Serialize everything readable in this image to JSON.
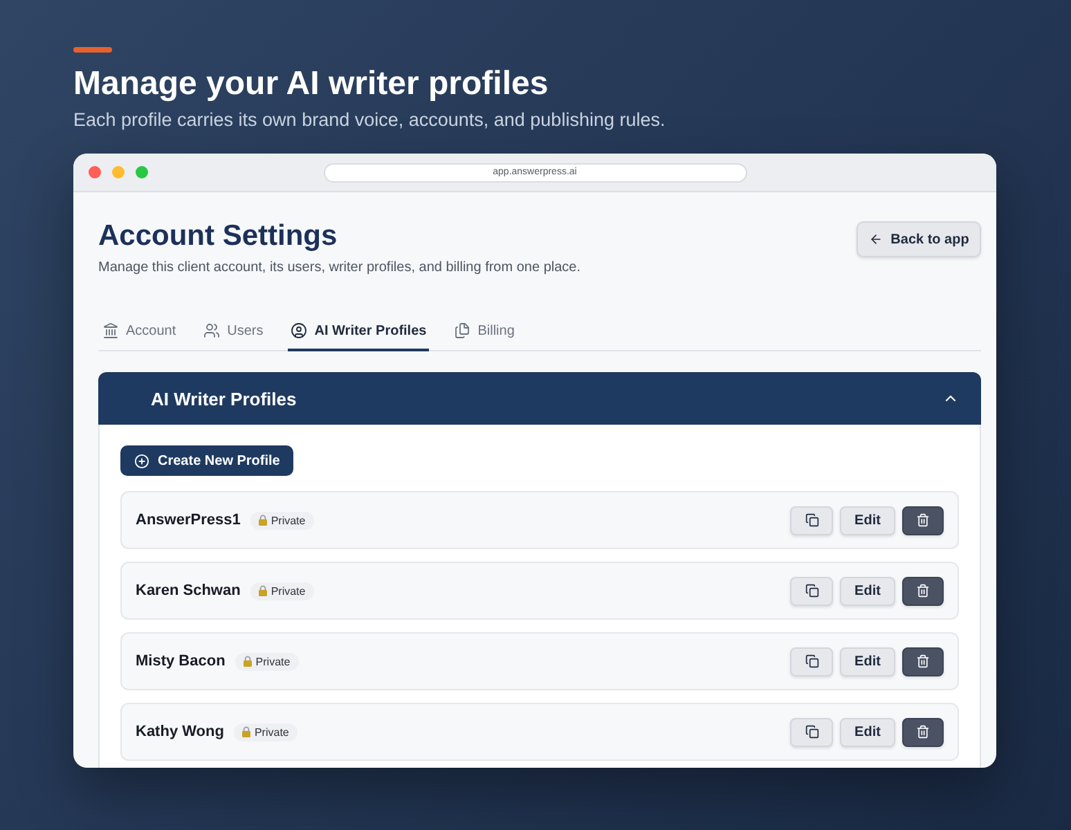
{
  "hero": {
    "title": "Manage your AI writer profiles",
    "subtitle": "Each profile carries its own brand voice, accounts, and publishing rules."
  },
  "browser": {
    "url": "app.answerpress.ai"
  },
  "header": {
    "title": "Account Settings",
    "description": "Manage this client account, its users, writer profiles, and billing from one place.",
    "back_button": "Back to app"
  },
  "tabs": [
    {
      "label": "Account",
      "selected": false
    },
    {
      "label": "Users",
      "selected": false
    },
    {
      "label": "AI Writer Profiles",
      "selected": true
    },
    {
      "label": "Billing",
      "selected": false
    }
  ],
  "panel": {
    "title": "AI Writer Profiles",
    "expanded": true,
    "create_button": "Create New Profile",
    "profiles": [
      {
        "name": "AnswerPress1",
        "badge": "Private",
        "edit_button": "Edit"
      },
      {
        "name": "Karen Schwan",
        "badge": "Private",
        "edit_button": "Edit"
      },
      {
        "name": "Misty Bacon",
        "badge": "Private",
        "edit_button": "Edit"
      },
      {
        "name": "Kathy Wong",
        "badge": "Private",
        "edit_button": "Edit"
      }
    ]
  }
}
